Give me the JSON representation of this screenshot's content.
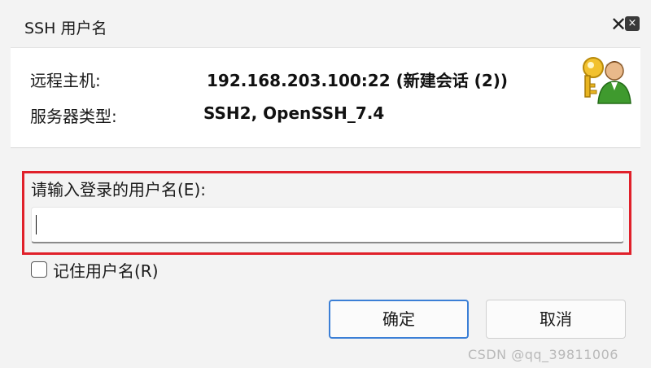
{
  "window": {
    "title": "SSH 用户名",
    "close_glyph": "✕",
    "close_icon": "close-icon"
  },
  "info": {
    "host_label": "远程主机:",
    "host_value": "192.168.203.100:22 (新建会话 (2))",
    "server_type_label": "服务器类型:",
    "server_type_value": "SSH2, OpenSSH_7.4",
    "icon": "user-key-icon"
  },
  "form": {
    "username_label": "请输入登录的用户名(E):",
    "username_value": "",
    "remember_label": "记住用户名(R)",
    "remember_checked": false
  },
  "buttons": {
    "ok_label": "确定",
    "cancel_label": "取消"
  },
  "watermark": "CSDN @qq_39811006",
  "colors": {
    "highlight_border": "#e0202a",
    "primary_border": "#3b7fd6"
  }
}
